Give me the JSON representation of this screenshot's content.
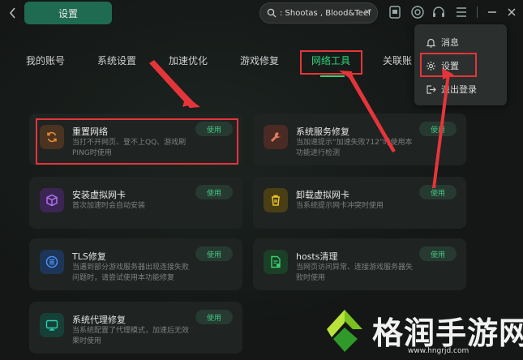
{
  "header": {
    "back_icon": "chevron-left-icon",
    "title": "设置",
    "search_text": ": Shootas , Blood&Teef"
  },
  "tabs": [
    {
      "label": "我的账号",
      "active": false
    },
    {
      "label": "系统设置",
      "active": false
    },
    {
      "label": "加速优化",
      "active": false
    },
    {
      "label": "游戏修复",
      "active": false
    },
    {
      "label": "网络工具",
      "active": true
    },
    {
      "label": "关联账",
      "active": false
    }
  ],
  "menu": {
    "items": [
      {
        "label": "消息",
        "icon": "bell-icon"
      },
      {
        "label": "设置",
        "icon": "gear-icon"
      },
      {
        "label": "退出登录",
        "icon": "logout-icon"
      }
    ]
  },
  "tools": [
    {
      "name": "重置网络",
      "desc": "当打不开网页、登不上QQ、游戏刷PING时使用",
      "button": "使用",
      "icon": "refresh-icon",
      "color": "#c86a1e"
    },
    {
      "name": "系统服务修复",
      "desc": "当加速提示“加速失败712”时使用本功能进行检测",
      "button": "使用",
      "icon": "wrench-icon",
      "color": "#b8604a"
    },
    {
      "name": "安装虚拟网卡",
      "desc": "首次加速时会自动安装",
      "button": "使用",
      "icon": "cube-icon",
      "color": "#8b4fc9"
    },
    {
      "name": "卸载虚拟网卡",
      "desc": "当系统提示网卡冲突时使用",
      "button": "使用",
      "icon": "trash-icon",
      "color": "#c9a21e"
    },
    {
      "name": "TLS修复",
      "desc": "当遇到部分游戏服务器出现连接失败问题时，请尝试使用本功能修复",
      "button": "使用",
      "icon": "list-icon",
      "color": "#2d6fd6"
    },
    {
      "name": "hosts清理",
      "desc": "当网页访问异常、连接游戏服务器失败时使用",
      "button": "使用",
      "icon": "file-icon",
      "color": "#2fa05a"
    },
    {
      "name": "系统代理修复",
      "desc": "当系统配置了代理模式，加速后无效果时使用",
      "button": "使用",
      "icon": "monitor-icon",
      "color": "#1fa38a"
    }
  ],
  "watermark": {
    "brand": "格润手游网",
    "url": "www.hngrjd.com"
  }
}
